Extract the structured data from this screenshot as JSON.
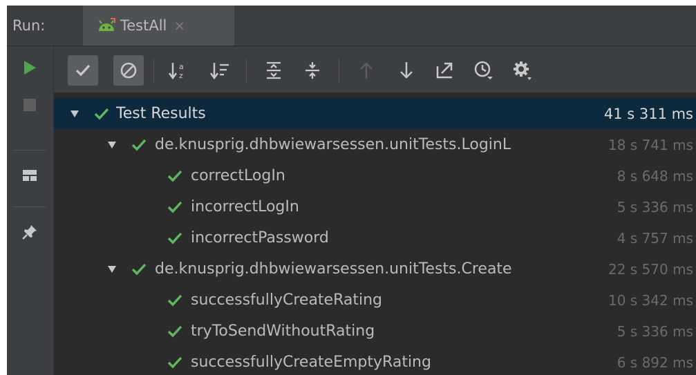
{
  "run_label": "Run:",
  "tab": {
    "label": "TestAll",
    "close": "×"
  },
  "icons": {
    "tab": "android-test-icon",
    "rerun": "play-icon",
    "stop": "stop-icon",
    "layout": "layout-icon",
    "pin": "pin-icon",
    "show_passed": "check-icon",
    "show_ignored": "ignored-icon",
    "sort_alpha": "sort-alphabetically-icon",
    "sort_duration": "sort-by-duration-icon",
    "expand_all": "expand-all-icon",
    "collapse_all": "collapse-all-icon",
    "prev_failed": "arrow-up-icon",
    "next_failed": "arrow-down-icon",
    "export": "export-icon",
    "history": "history-icon",
    "settings": "gear-icon"
  },
  "colors": {
    "pass": "#5fb760",
    "selected_row": "#0d293e",
    "text": "#bbbbbb",
    "time": "#6b6b6b"
  },
  "tree": {
    "root": {
      "label": "Test Results",
      "time": "41 s 311 ms"
    },
    "suites": [
      {
        "label": "de.knusprig.dhbwiewarsessen.unitTests.LoginL",
        "time": "18 s 741 ms",
        "tests": [
          {
            "label": "correctLogIn",
            "time": "8 s 648 ms"
          },
          {
            "label": "incorrectLogIn",
            "time": "5 s 336 ms"
          },
          {
            "label": "incorrectPassword",
            "time": "4 s 757 ms"
          }
        ]
      },
      {
        "label": "de.knusprig.dhbwiewarsessen.unitTests.Create",
        "time": "22 s 570 ms",
        "tests": [
          {
            "label": "successfullyCreateRating",
            "time": "10 s 342 ms"
          },
          {
            "label": "tryToSendWithoutRating",
            "time": "5 s 336 ms"
          },
          {
            "label": "successfullyCreateEmptyRating",
            "time": "6 s 892 ms"
          }
        ]
      }
    ]
  }
}
